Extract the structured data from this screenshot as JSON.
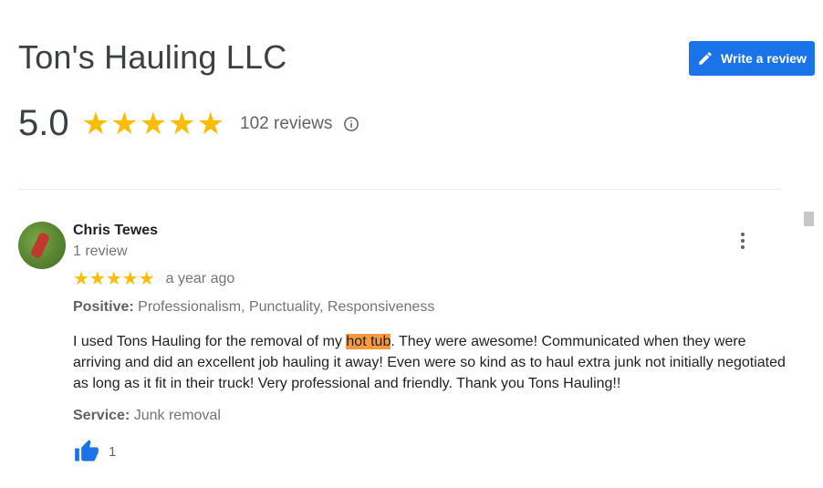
{
  "business": {
    "name": "Ton's Hauling LLC",
    "write_review_label": "Write a review",
    "rating": "5.0",
    "stars": "★★★★★",
    "review_count_label": "102 reviews"
  },
  "review": {
    "author": "Chris Tewes",
    "author_reviews": "1 review",
    "stars": "★★★★★",
    "time": "a year ago",
    "positive_label": "Positive:",
    "positive_text": "Professionalism, Punctuality, Responsiveness",
    "text_before": "I used Tons Hauling for the removal of my ",
    "text_highlight": "hot tub",
    "text_after": ".  They were awesome!  Communicated when they were arriving and did an excellent job hauling it away!  Even were so kind as to haul extra junk not initially negotiated as long as it fit in their truck!   Very professional and friendly.  Thank you Tons Hauling!!",
    "service_label": "Service:",
    "service_text": "Junk removal",
    "likes": "1"
  },
  "colors": {
    "accent": "#1a73e8",
    "star": "#fbbc04",
    "highlight": "#f6993f"
  },
  "icons": {
    "write": "pencil-icon",
    "info": "info-icon",
    "more": "more-vert-icon",
    "like": "thumbs-up-icon"
  }
}
